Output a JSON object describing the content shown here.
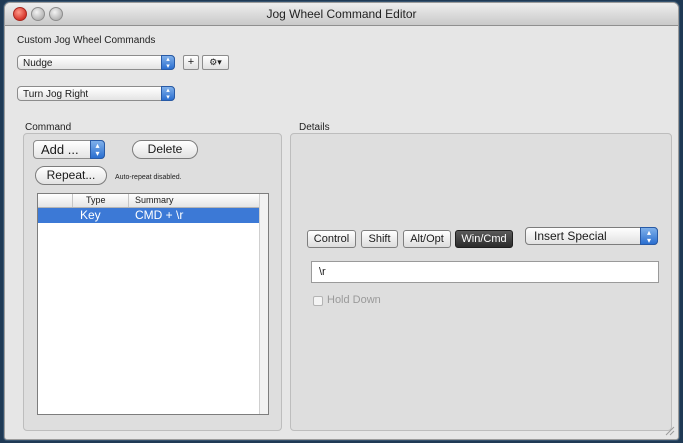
{
  "window": {
    "title": "Jog Wheel Command Editor"
  },
  "custom_commands": {
    "label": "Custom Jog Wheel Commands",
    "preset_value": "Nudge",
    "add_symbol": "+",
    "gear_menu": "⚙▾"
  },
  "command_selector": {
    "value": "Turn Jog Right"
  },
  "command": {
    "group_label": "Command",
    "add_value": "Add ...",
    "delete_label": "Delete",
    "repeat_label": "Repeat...",
    "repeat_status": "Auto-repeat disabled.",
    "table": {
      "columns": [
        "Type",
        "Summary"
      ],
      "rows": [
        {
          "type": "Key",
          "summary": "CMD + \\r"
        }
      ]
    }
  },
  "details": {
    "group_label": "Details",
    "modifiers": [
      {
        "label": "Control",
        "active": false
      },
      {
        "label": "Shift",
        "active": false
      },
      {
        "label": "Alt/Opt",
        "active": false
      },
      {
        "label": "Win/Cmd",
        "active": true
      }
    ],
    "insert_special_value": "Insert Special",
    "key_field_value": "\\r",
    "hold_down_label": "Hold Down",
    "hold_down_checked": false,
    "hold_down_enabled": false
  },
  "colors": {
    "selection": "#3c79d6",
    "active_modifier": "#2b2b2b",
    "popup_stepper": "#2b6fd0"
  },
  "icons": [
    "close-icon",
    "minimize-icon",
    "zoom-icon",
    "gear-icon",
    "plus-icon",
    "stepper-arrows-icon",
    "resize-grip-icon"
  ]
}
